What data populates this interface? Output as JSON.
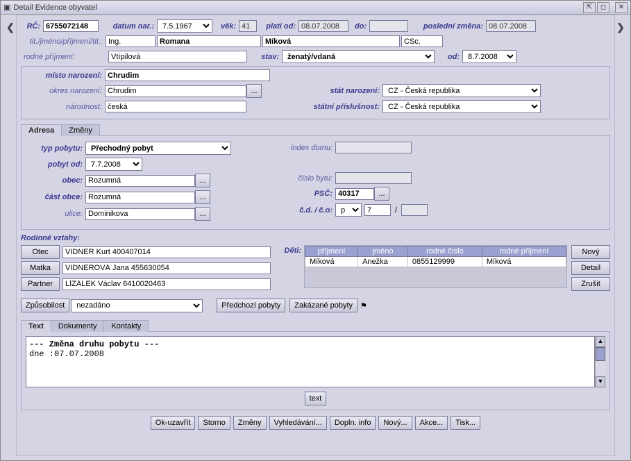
{
  "window": {
    "title": "Detail Evidence obyvatel"
  },
  "top": {
    "rc_label": "RČ:",
    "rc": "6755072148",
    "dn_label": "datum nar.:",
    "dn": "7.5.1967",
    "vek_label": "věk:",
    "vek": "41",
    "po_label": "platí od:",
    "po": "08.07.2008",
    "do_label": "do:",
    "do_val": "",
    "pz_label": "poslední změna:",
    "pz": "08.07.2008"
  },
  "name": {
    "label": "tit./jméno/příjmení/tit.:",
    "tit1": "Ing.",
    "first": "Romana",
    "last": "Míková",
    "tit2": "CSc."
  },
  "maiden": {
    "label": "rodné příjmení:",
    "val": "Vtípilová",
    "stav_label": "stav:",
    "stav": "ženatý/vdaná",
    "od_label": "od:",
    "od": "8.7.2008"
  },
  "birth": {
    "misto_label": "místo narození:",
    "misto": "Chrudim",
    "okres_label": "okres narození:",
    "okres": "Chrudim",
    "narodnost_label": "národnost:",
    "narodnost": "česká",
    "stat_label": "stát narození:",
    "stat": "CZ - Česká republika",
    "prisl_label": "státní příslušnost:",
    "prisl": "CZ - Česká republika"
  },
  "addr_tabs": {
    "adresa": "Adresa",
    "zmeny": "Změny"
  },
  "addr": {
    "typ_label": "typ pobytu:",
    "typ": "Přechodný pobyt",
    "pobyt_od_label": "pobyt od:",
    "pobyt_od": "7.7.2008",
    "obec_label": "obec:",
    "obec": "Rozumná",
    "cast_label": "část obce:",
    "cast": "Rozumná",
    "ulice_label": "ulice:",
    "ulice": "Dominikova",
    "index_label": "index domu:",
    "index": "",
    "byt_label": "číslo bytu:",
    "byt": "",
    "psc_label": "PSČ:",
    "psc": "40317",
    "cd_label": "č.d. / č.o:",
    "cd_sel": "p",
    "cd": "7",
    "slash": "/",
    "co": ""
  },
  "rel": {
    "heading": "Rodinné vztahy:",
    "otec_btn": "Otec",
    "otec": "VIDNER Kurt 400407014",
    "matka_btn": "Matka",
    "matka": "VIDNEROVÁ Jana 455630054",
    "partner_btn": "Partner",
    "partner": "LÍZÁLEK Václav 6410020463",
    "deti_label": "Děti:",
    "cols": {
      "prijmeni": "příjmení",
      "jmeno": "jméno",
      "rc": "rodné číslo",
      "rp": "rodné příjmení"
    },
    "rows": [
      {
        "prijmeni": "Míková",
        "jmeno": "Anežka",
        "rc": "0855129999",
        "rp": "Míková"
      }
    ],
    "novy": "Nový",
    "detail": "Detail",
    "zrusit": "Zrušit"
  },
  "midbtns": {
    "zpusobilost_btn": "Způsobilost",
    "zpusobilost_val": "nezadáno",
    "predchozi": "Předchozí pobyty",
    "zakazane": "Zakázané pobyty"
  },
  "tabs2": {
    "text": "Text",
    "dokumenty": "Dokumenty",
    "kontakty": "Kontakty"
  },
  "textarea": {
    "line1": "--- Změna druhu pobytu ---",
    "line2": "dne :07.07.2008"
  },
  "text_btn": "text",
  "footer": {
    "ok": "Ok-uzavřít",
    "storno": "Storno",
    "zmeny": "Změny",
    "vyhl": "Vyhledávání...",
    "dopln": "Dopln. info",
    "novy": "Nový...",
    "akce": "Akce...",
    "tisk": "Tisk..."
  },
  "dots": "..."
}
